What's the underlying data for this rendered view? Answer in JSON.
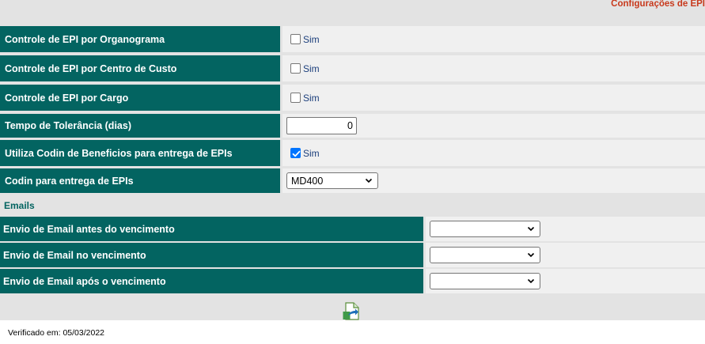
{
  "page_title": "Configurações de EPI",
  "rows": [
    {
      "label": "Controle de EPI por Organograma",
      "type": "checkbox",
      "checked": false,
      "check_label": "Sim"
    },
    {
      "label": "Controle de EPI por Centro de Custo",
      "type": "checkbox",
      "checked": false,
      "check_label": "Sim"
    },
    {
      "label": "Controle de EPI por Cargo",
      "type": "checkbox",
      "checked": false,
      "check_label": "Sim"
    },
    {
      "label": "Tempo de Tolerância (dias)",
      "type": "number",
      "value": "0"
    },
    {
      "label": "Utiliza Codin de Beneficios para entrega de EPIs",
      "type": "checkbox",
      "checked": true,
      "check_label": "Sim"
    },
    {
      "label": "Codin para entrega de EPIs",
      "type": "select",
      "selected": "MD400"
    }
  ],
  "emails": {
    "section_label": "Emails",
    "rows": [
      {
        "label": "Envio de Email antes do vencimento",
        "selected": ""
      },
      {
        "label": "Envio de Email no vencimento",
        "selected": ""
      },
      {
        "label": "Envio de Email após o vencimento",
        "selected": ""
      }
    ]
  },
  "footer": {
    "icon": "save-document-icon",
    "verified_text": "Verificado em: 05/03/2022"
  },
  "colors": {
    "label_bg": "#036461",
    "title": "#c8391c",
    "panel_bg": "#e3e3e3",
    "value_bg": "#f0f0f0",
    "check_accent": "#0075ff"
  }
}
